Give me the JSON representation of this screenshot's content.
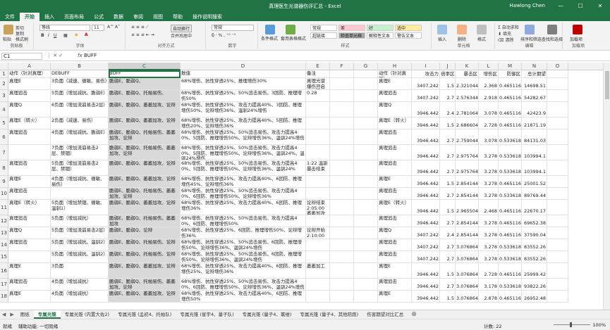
{
  "window": {
    "title": "真理医生光谱器伤评汇总 - Excel",
    "user": "Hawlong Chen"
  },
  "tabs": [
    "文件",
    "开始",
    "插入",
    "页面布局",
    "公式",
    "数据",
    "审阅",
    "视图",
    "帮助",
    "操作说明搜索"
  ],
  "active_tab": "开始",
  "ribbon": {
    "clipboard": {
      "label": "剪贴板",
      "paste": "粘贴",
      "cut": "剪切",
      "copy": "复制",
      "painter": "格式刷"
    },
    "font": {
      "label": "字体",
      "name": "等线",
      "size": "11"
    },
    "align": {
      "label": "对齐方式",
      "wrap": "自动换行",
      "merge": "合并后居中"
    },
    "number": {
      "label": "数字",
      "format": "常规"
    },
    "styles": {
      "label": "样式",
      "cond": "条件格式",
      "table": "套用表格格式",
      "cells": [
        {
          "t": "常规",
          "bg": "#ffffff"
        },
        {
          "t": "差",
          "bg": "#ffc7ce"
        },
        {
          "t": "好",
          "bg": "#c6efce"
        },
        {
          "t": "适中",
          "bg": "#ffeb9c"
        },
        {
          "t": "超链接",
          "bg": "#ffffff"
        },
        {
          "t": "检查单元格",
          "bg": "#a5a5a5"
        },
        {
          "t": "解释性文本",
          "bg": "#ffffff"
        },
        {
          "t": "警告文本",
          "bg": "#ffffff"
        }
      ]
    },
    "cells": {
      "label": "单元格",
      "insert": "插入",
      "delete": "删除",
      "format": "格式"
    },
    "editing": {
      "label": "编辑",
      "autosum": "自动求和",
      "fill": "填充",
      "clear": "清除",
      "sort": "排序和筛选",
      "find": "查找和选择"
    },
    "addins": {
      "label": "加载项",
      "btn": "加载项"
    }
  },
  "formula_bar": {
    "name_box": "C1",
    "fx": "fx",
    "value": "BUFF"
  },
  "columns": [
    "A",
    "B",
    "C",
    "D",
    "E",
    "F",
    "G",
    "H",
    "I",
    "J",
    "K",
    "L",
    "M",
    "N",
    "O"
  ],
  "selected_column": "C",
  "rows": [
    {
      "n": "1",
      "a": "动作（针对真理）",
      "b": "DEBUFF",
      "c": "BUFF",
      "d": "数值",
      "e": "备注",
      "h": "动作（针对真理）",
      "i": "攻击力",
      "j": "倍率区",
      "k": "暴击区",
      "l": "增伤区",
      "m": "防御区",
      "n2": "总计期望"
    },
    {
      "n": "2",
      "a": "真理E",
      "b": "3负面（减速、缠敏、易伤）",
      "c": "脆弱E、脆弱Q、",
      "d": "68%增伤、抗性穿透25%、推理增伤30%",
      "e": "真理光谱爆伤开启全程覆盖",
      "h": "真理E",
      "i": "3407.242",
      "j": "1.5",
      "k": "2.321044",
      "l": "2.368",
      "m": "0.465116",
      "n2": "14698.51"
    },
    {
      "n": "3",
      "a": "真理追击",
      "b": "5负面（增加减抗、脆弱E）",
      "c": "脆弱E、脆弱Q、托帕易伤、",
      "d": "68%增伤、抗性穿透25%、50%追击易伤、3回防、推理增伤50%",
      "e": "0.28",
      "h": "真理追击",
      "i": "3407.242",
      "j": "2.7",
      "k": "2.576344",
      "l": "2.918",
      "m": "0.465116",
      "n2": "54282.67"
    },
    {
      "n": "4",
      "a": "真理Q",
      "b": "6负面（增加流崩易击2层）",
      "c": "脆弱E、脆弱Q、萎萎加攻、论辩",
      "d": "68%增伤、抗性穿透25%、攻击力提高40%、3回防、推理增伤50%、论辩增伤36%、温驯24%增伤",
      "e": "",
      "h": "真理Q",
      "i": "3946.442",
      "j": "2.4",
      "k": "2.781064",
      "l": "3.078",
      "m": "0.465116",
      "n2": "42423.9"
    },
    {
      "n": "5",
      "a": "真理E（转火）",
      "b": "2负面（减速、易伤）",
      "c": "脆弱E、脆弱Q、萎萎加攻、论辩",
      "d": "68%增伤、抗性穿透25%、攻击力提高40%、5回防、推理增伤20%、论辩增伤36%",
      "e": "",
      "h": "真理E（转火）",
      "i": "3946.442",
      "j": "1.5",
      "k": "2.686604",
      "l": "2.728",
      "m": "0.465116",
      "n2": "21871.19"
    },
    {
      "n": "6",
      "a": "真理追击",
      "b": "4负面（增加减抗、脆弱E）",
      "c": "脆弱E、脆弱Q、托帕易伤、萎萎加攻、论辩",
      "d": "68%增伤、抗性穿透25%、50%追击易伤、攻击力提高40%、5回防、推理增伤50%、论辩增伤36%、温驯24%增伤",
      "e": "",
      "h": "真理追击",
      "i": "3946.442",
      "j": "2.7",
      "k": "2.759044",
      "l": "3.078",
      "m": "0.533618",
      "n2": "84131.03"
    },
    {
      "n": "7",
      "a": "",
      "b": "7负面（增加流崩易击2层、禁锢）",
      "c": "脆弱E、脆弱Q、托帕易伤、萎萎加攻、论辩",
      "d": "68%增伤、抗性穿透25%、50%追击易伤、攻击力提高40%、5回防、推理增伤50%、论辩增伤36%、温驯24%、温驯24%增伤",
      "e": "",
      "h": "真理追击",
      "i": "3946.442",
      "j": "2.7",
      "k": "2.975764",
      "l": "3.278",
      "m": "0.533618",
      "n2": "103994.1"
    },
    {
      "n": "8",
      "a": "真理追击",
      "b": "5负面（增加流崩易击2层、禁锢）",
      "c": "脆弱E、脆弱Q、萎萎加攻、论辩",
      "d": "68%增伤、抗性穿透25%、50%追击易伤、攻击力提高40%、5回防、推理增伤50%、论辩增伤36%、温驯24%",
      "e": "1:22 温驯暴击结束",
      "h": "真理追击",
      "i": "3946.442",
      "j": "2.7",
      "k": "2.975764",
      "l": "3.278",
      "m": "0.533618",
      "n2": "103994.1"
    },
    {
      "n": "9",
      "a": "真理E",
      "b": "4负面（增加减抗、缠敏、易伤）",
      "c": "脆弱E、脆弱Q、萎萎加攻、论辩",
      "d": "68%增伤、抗性穿透25%、攻击力提高40%、6回防、推理增伤45%、论辩增伤36%",
      "e": "",
      "h": "真理E",
      "i": "3946.442",
      "j": "1.5",
      "k": "2.854144",
      "l": "3.278",
      "m": "0.465116",
      "n2": "25001.52"
    },
    {
      "n": "10",
      "a": "真理追击",
      "b": "",
      "c": "脆弱E、脆弱Q、托帕易伤、萎萎加攻、论辩",
      "d": "68%增伤、抗性穿透25%、50%追击易伤、攻击力提高40%、6回防、推理增伤50%、论辩增伤36%",
      "e": "",
      "h": "真理追击",
      "i": "3946.442",
      "j": "2.7",
      "k": "2.854144",
      "l": "3.278",
      "m": "0.533618",
      "n2": "89769.44"
    },
    {
      "n": "11",
      "a": "真理E（转火）",
      "b": "5负面（增加禁锢、缠敏、温驯1）",
      "c": "脆弱E、脆弱Q、萎萎加攻、论辩",
      "d": "68%增伤、抗性穿透25%、攻击力提高40%、6回防、推理增伤36%",
      "e": "论辩结束2:05:00 萎萎加攻结束",
      "h": "真理E（转火）",
      "i": "3946.442",
      "j": "1.5",
      "k": "2.965504",
      "l": "2.468",
      "m": "0.465116",
      "n2": "22670.17"
    },
    {
      "n": "12",
      "a": "真理追击",
      "b": "5负面（增加减抗）",
      "c": "脆弱E、脆弱Q、托帕易伤、萎萎加攻",
      "d": "68%增伤、抗性穿透25%、50%追击易伤、攻击力提高40%、6回防、推理增伤50%",
      "e": "",
      "h": "真理追击",
      "i": "3946.442",
      "j": "2.7",
      "k": "2.854144",
      "l": "3.278",
      "m": "0.465116",
      "n2": "69652.38"
    },
    {
      "n": "13",
      "a": "真理Q",
      "b": "5负面（增加流崩易击2层）",
      "c": "脆弱E、脆弱Q、论辩",
      "d": "68%增伤、抗性穿透25%、6回防、推理增伤50%、论辩增伤36%",
      "e": "论辩开始2:10:00",
      "h": "真理Q",
      "i": "3407.242",
      "j": "2.4",
      "k": "2.854144",
      "l": "3.278",
      "m": "0.465116",
      "n2": "37590.04"
    },
    {
      "n": "14",
      "a": "真理追击",
      "b": "5负面（增加减抗、温驯2）",
      "c": "脆弱E、脆弱Q、托帕易伤、论辩",
      "d": "68%增伤、抗性穿透25%、50%追击易伤、6回防、推理增伤50%、论辩增伤36%、温驯24%增伤",
      "e": "",
      "h": "真理追击",
      "i": "3407.242",
      "j": "2.7",
      "k": "3.076864",
      "l": "3.278",
      "m": "0.533618",
      "n2": "83552.26"
    },
    {
      "n": "15",
      "a": "",
      "b": "5负面（增加减抗、温驯2）",
      "c": "脆弱E、脆弱Q、托帕易伤、论辩",
      "d": "68%增伤、抗性穿透25%、50%追击易伤、6回防、推理增伤50%、论辩增伤36%、温驯24%增伤",
      "e": "",
      "h": "真理追击",
      "i": "3407.242",
      "j": "2.7",
      "k": "3.076864",
      "l": "3.278",
      "m": "0.533618",
      "n2": "83552.26"
    },
    {
      "n": "16",
      "a": "真理E",
      "b": "3负面",
      "c": "脆弱E、脆弱Q、萎萎加攻、论辩",
      "d": "68%增伤、抗性穿透25%、攻击力提高40%、6回防、推理增伤25%、论辩增伤36%",
      "e": "萎萎加工",
      "h": "真理E",
      "i": "3946.442",
      "j": "1.5",
      "k": "3.076864",
      "l": "2.728",
      "m": "0.465116",
      "n2": "25999.42"
    },
    {
      "n": "17",
      "a": "真理追击",
      "b": "4负面（增加减抗）",
      "c": "脆弱E、脆弱Q、托帕易伤、萎萎加攻、论辩",
      "d": "68%增伤、抗性穿透25%、50%追击易伤、攻击力提高40%、6回防、推理增伤50%、论辩增伤36%、温驯24%增伤",
      "e": "",
      "h": "真理追击",
      "i": "3946.442",
      "j": "2.7",
      "k": "3.076864",
      "l": "3.178",
      "m": "0.533618",
      "n2": "93822.26"
    },
    {
      "n": "18",
      "a": "真理E",
      "b": "4负面（增加减抗）",
      "c": "脆弱E、脆弱Q、萎萎加攻、论辩",
      "d": "68%增伤、抗性穿透25%、攻击力提高40%、6回防、推理增伤50%",
      "e": "",
      "h": "真理E",
      "i": "3946.442",
      "j": "1.5",
      "k": "3.076864",
      "l": "2.878",
      "m": "0.465116",
      "n2": "26952.48"
    }
  ],
  "sheets": [
    "图纸",
    "专属光锥",
    "专属光锥 (内置大佐2)",
    "专属光锥 (孟初4、托帕队)",
    "专属光锥 (星宇4、量子队)",
    "专属光锥 (量子4、寰维)",
    "专属光锥 (量子4、其他陪跑)",
    "伤害期望对比汇总"
  ],
  "active_sheet": "专属光锥",
  "status": {
    "ready": "就绪",
    "accessibility": "辅助功能: 一切就绪",
    "count": "计数: 22",
    "zoom": "100%"
  }
}
